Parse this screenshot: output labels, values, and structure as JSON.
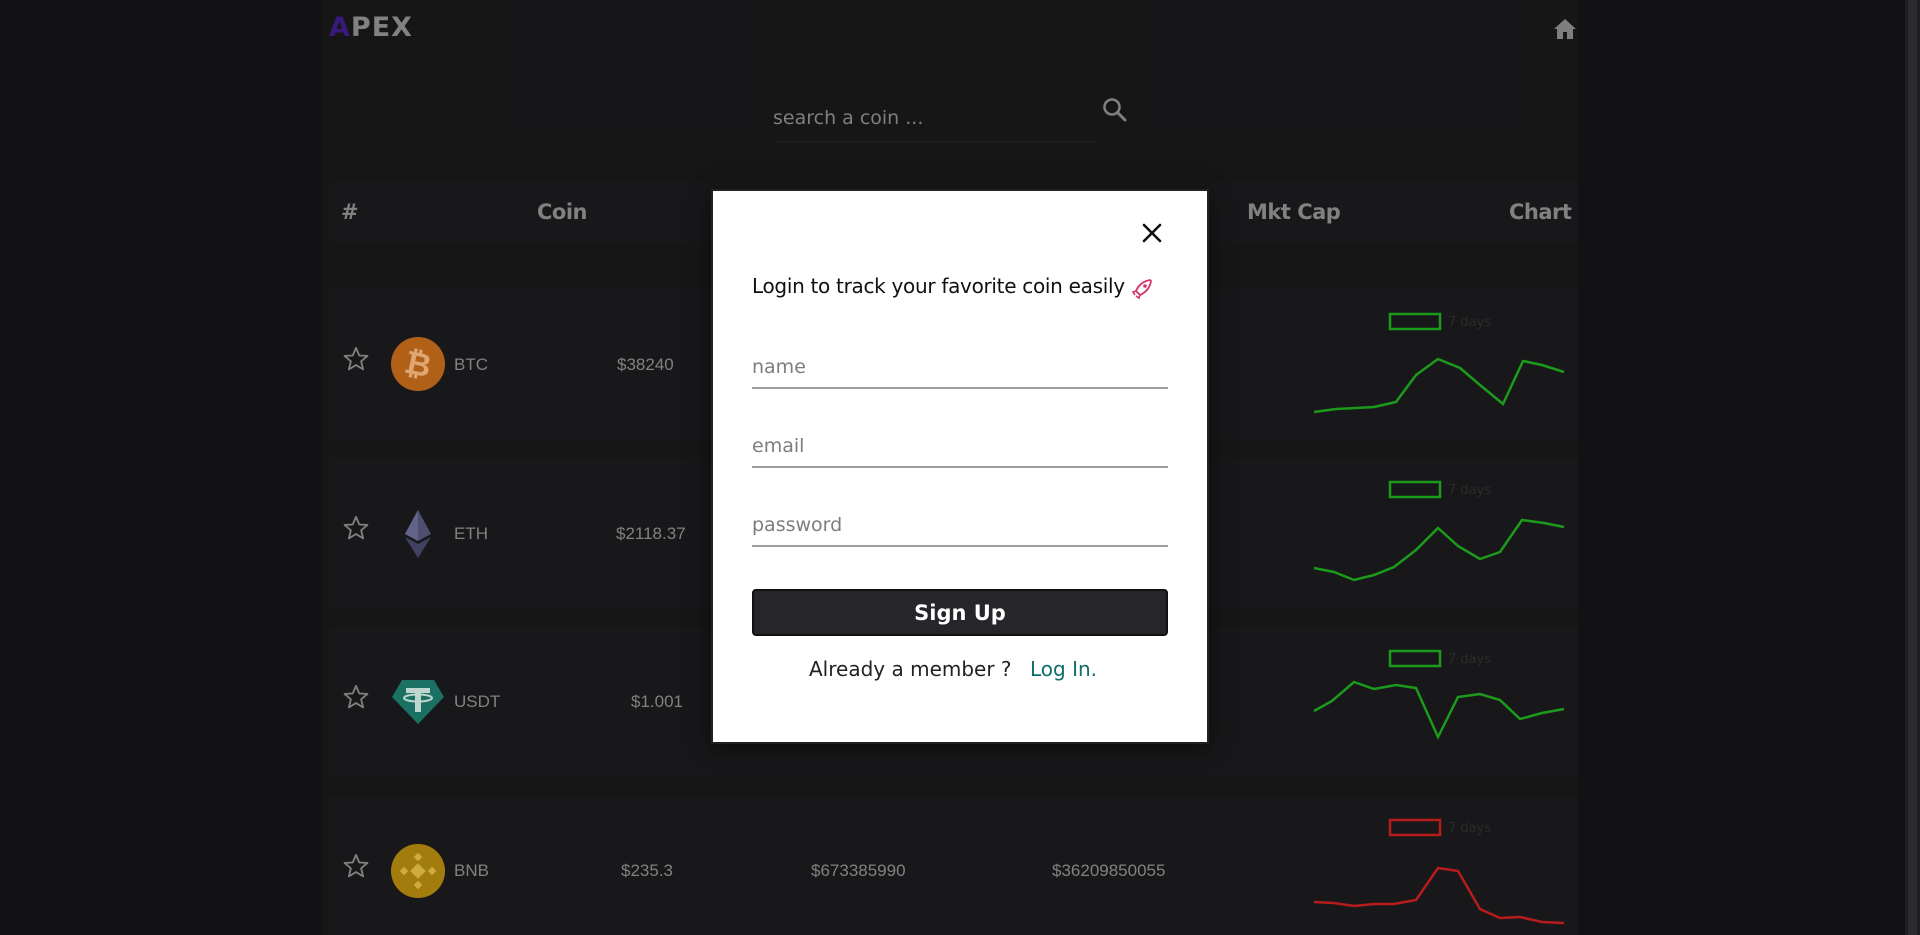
{
  "header": {
    "logo_first": "A",
    "logo_rest": "PEX",
    "home_icon": "home-icon"
  },
  "search": {
    "placeholder": "search a coin ...",
    "icon": "search-icon"
  },
  "table": {
    "columns": [
      "#",
      "Coin",
      "Mkt Cap",
      "Chart"
    ],
    "rows": [
      {
        "symbol": "BTC",
        "price": "$38240",
        "volume": "",
        "mkt_cap": "",
        "chart_label": "7 days",
        "trend": "up",
        "color": "#1fa81f"
      },
      {
        "symbol": "ETH",
        "price": "$2118.37",
        "volume": "",
        "mkt_cap": "",
        "chart_label": "7 days",
        "trend": "up",
        "color": "#1fa81f"
      },
      {
        "symbol": "USDT",
        "price": "$1.001",
        "volume": "",
        "mkt_cap": "",
        "chart_label": "7 days",
        "trend": "up",
        "color": "#1fa81f"
      },
      {
        "symbol": "BNB",
        "price": "$235.3",
        "volume": "$673385990",
        "mkt_cap": "$36209850055",
        "chart_label": "7 days",
        "trend": "down",
        "color": "#c81e1e"
      }
    ]
  },
  "modal": {
    "title": "Login to track your favorite coin easily",
    "name_placeholder": "name",
    "email_placeholder": "email",
    "password_placeholder": "password",
    "signup_label": "Sign Up",
    "member_text": "Already a member ?",
    "login_label": "Log In."
  },
  "colors": {
    "background": "#141416",
    "logo_accent": "#3d1d86",
    "up": "#1fa81f",
    "down": "#c81e1e",
    "link": "#0e6e6e"
  }
}
